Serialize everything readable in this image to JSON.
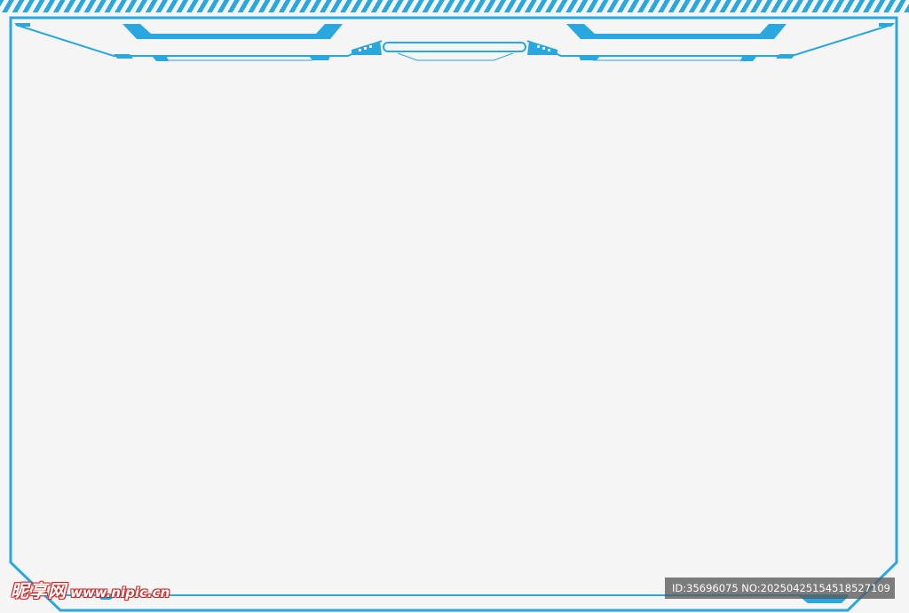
{
  "colors": {
    "frame_blue": "#29a8e0",
    "background": "#f5f5f5",
    "watermark_red": "#cc2222",
    "watermark_box": "#5a5a5a"
  },
  "watermark": {
    "logo_text": "昵享网",
    "logo_url": "www.nipic.cn",
    "id_text": "ID:35696075 NO:20250425154518527109"
  }
}
